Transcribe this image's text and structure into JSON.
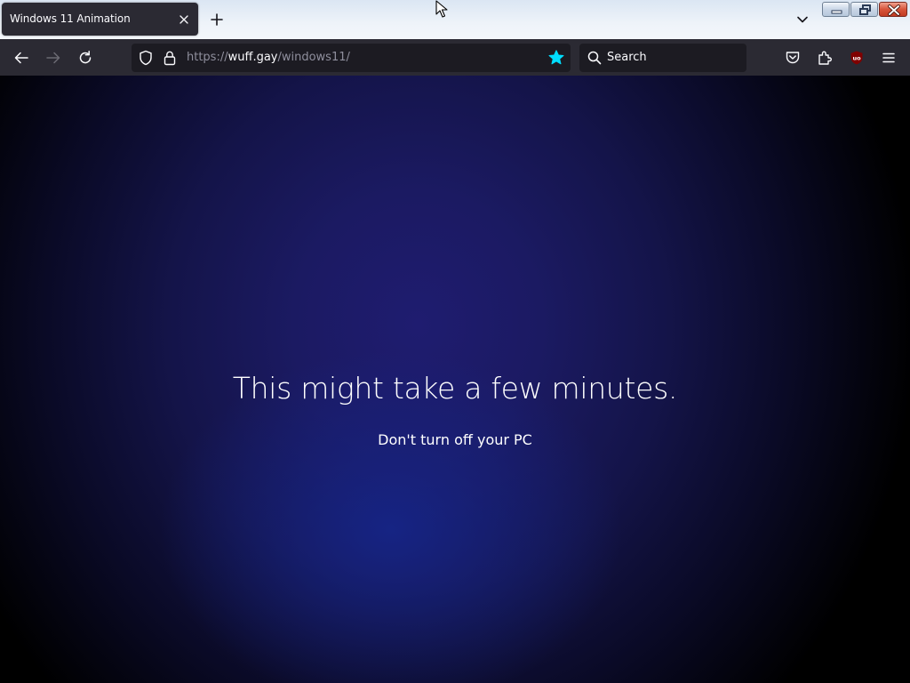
{
  "tab": {
    "title": "Windows 11 Animation"
  },
  "urlbar": {
    "scheme": "https://",
    "host": "wuff.gay",
    "path": "/windows11/"
  },
  "search": {
    "placeholder": "Search"
  },
  "extension": {
    "badge": "uo"
  },
  "page": {
    "headline": "This might take a few minutes.",
    "subtext": "Don't turn off your PC"
  },
  "colors": {
    "toolbar": "#2b2a33",
    "field": "#1c1b22",
    "bookmark_star": "#00ddff",
    "extension_red": "#800000",
    "page_accent": "#1b1a62"
  }
}
